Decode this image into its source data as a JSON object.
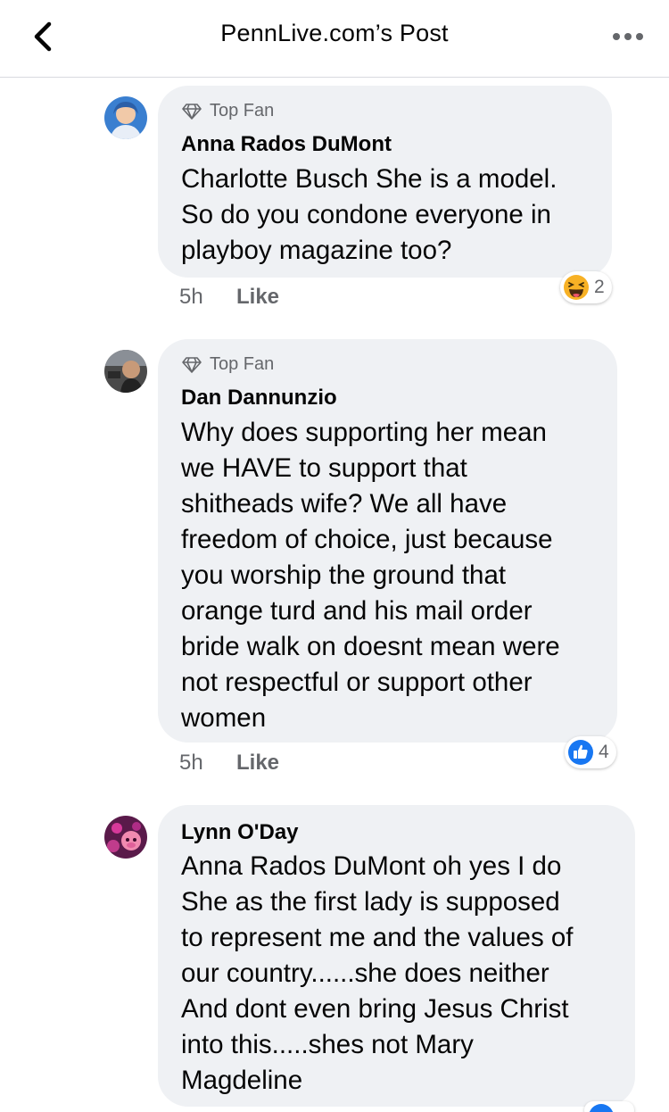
{
  "header": {
    "title": "PennLive.com’s Post"
  },
  "comments": [
    {
      "badge": "Top Fan",
      "author": "Anna Rados DuMont",
      "lines": [
        "Charlotte Busch She is a model.",
        "So do you condone everyone in",
        "playboy magazine too?"
      ],
      "time": "5h",
      "like_label": "Like",
      "reaction_icon": "haha-reaction-icon",
      "reaction_count": "2"
    },
    {
      "badge": "Top Fan",
      "author": "Dan Dannunzio",
      "lines": [
        "Why does supporting her mean",
        "we HAVE to support that",
        "shitheads wife? We all have",
        "freedom of choice, just because",
        "you worship the ground that",
        "orange turd and his mail order",
        "bride walk on doesnt mean were",
        "not respectful or support other",
        "women"
      ],
      "time": "5h",
      "like_label": "Like",
      "reaction_icon": "like-reaction-icon",
      "reaction_count": "4"
    },
    {
      "author": "Lynn O'Day",
      "lines": [
        "Anna Rados DuMont oh yes I do",
        "She as the first lady is supposed",
        "to represent me and the values of",
        "our country......she does neither",
        "And dont even bring Jesus Christ",
        "into this.....shes not Mary",
        "Magdeline"
      ]
    }
  ],
  "colors": {
    "bubble": "#eff1f4",
    "secondary_text": "#65676b",
    "like_blue": "#1877f2",
    "haha_yellow": "#f7b125"
  }
}
